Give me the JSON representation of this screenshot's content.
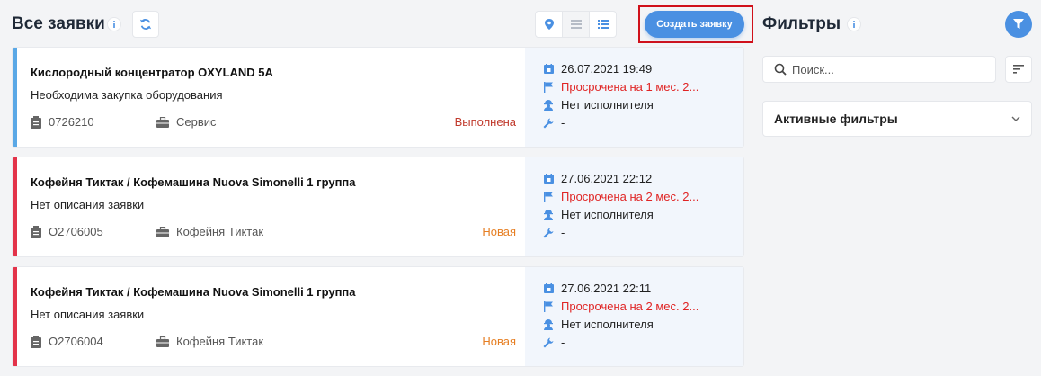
{
  "header": {
    "title": "Все заявки",
    "create_label": "Создать заявку"
  },
  "filters": {
    "title": "Фильтры",
    "search_placeholder": "Поиск...",
    "active_filters_label": "Активные фильтры"
  },
  "colors": {
    "accent": "#4a90e2",
    "stripe_done": "#5aa8e6",
    "stripe_new": "#e3334a",
    "status_done": "#c0392b",
    "status_new": "#e67e22",
    "overdue": "#e02424",
    "highlight": "#d0101a"
  },
  "requests": [
    {
      "title": "Кислородный концентратор OXYLAND 5A",
      "description": "Необходима закупка оборудования",
      "number": "0726210",
      "client": "Сервис",
      "status": "Выполнена",
      "date": "26.07.2021 19:49",
      "overdue": "Просрочена на 1 мес. 2...",
      "executor": "Нет исполнителя",
      "work": "-"
    },
    {
      "title": "Кофейня Тиктак / Кофемашина Nuova Simonelli 1 группа",
      "description": "Нет описания заявки",
      "number": "O2706005",
      "client": "Кофейня Тиктак",
      "status": "Новая",
      "date": "27.06.2021 22:12",
      "overdue": "Просрочена на 2 мес. 2...",
      "executor": "Нет исполнителя",
      "work": "-"
    },
    {
      "title": "Кофейня Тиктак / Кофемашина Nuova Simonelli 1 группа",
      "description": "Нет описания заявки",
      "number": "O2706004",
      "client": "Кофейня Тиктак",
      "status": "Новая",
      "date": "27.06.2021 22:11",
      "overdue": "Просрочена на 2 мес. 2...",
      "executor": "Нет исполнителя",
      "work": "-"
    }
  ]
}
